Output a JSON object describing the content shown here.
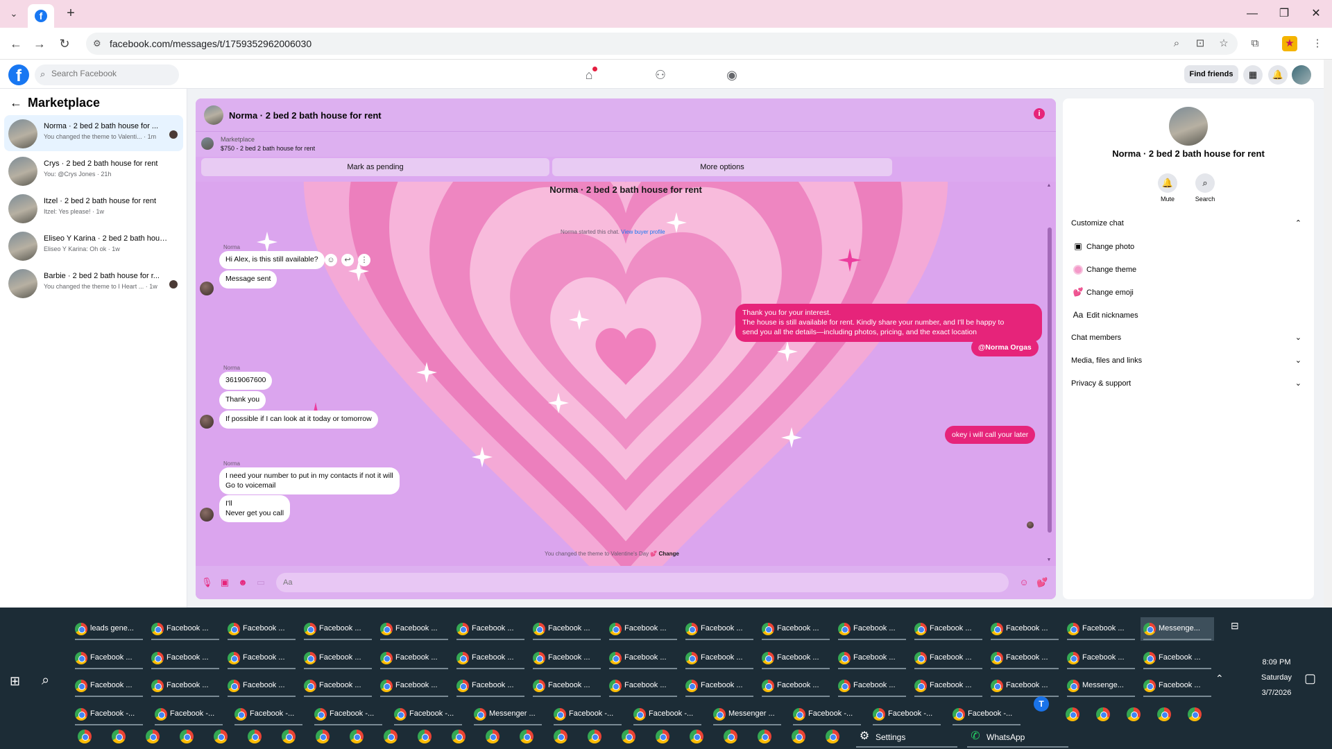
{
  "browser": {
    "url": "facebook.com/messages/t/1759352962006030",
    "new_tab": "+",
    "controls": {
      "minimize": "—",
      "maximize": "❐",
      "close": "✕"
    }
  },
  "fb_header": {
    "search_placeholder": "Search Facebook",
    "find_friends": "Find friends"
  },
  "sidebar": {
    "title": "Marketplace",
    "conversations": [
      {
        "name": "Norma · 2 bed 2 bath house for ...",
        "sub": "You changed the theme to Valenti... · 1m"
      },
      {
        "name": "Crys · 2 bed 2 bath house for rent",
        "sub": "You: @Crys Jones · 21h"
      },
      {
        "name": "Itzel · 2 bed 2 bath house for rent",
        "sub": "Itzel: Yes please! · 1w"
      },
      {
        "name": "Eliseo Y Karina · 2 bed 2 bath hous...",
        "sub": "Eliseo Y Karina: Oh ok · 1w"
      },
      {
        "name": "Barbie · 2 bed 2 bath house for r...",
        "sub": "You changed the theme to I Heart ... · 1w"
      }
    ]
  },
  "chat": {
    "title": "Norma · 2 bed 2 bath house for rent",
    "marketplace_label": "Marketplace",
    "listing": "$750 - 2 bed 2 bath house for rent",
    "mark_pending": "Mark as pending",
    "more_options": "More options",
    "body_title": "Norma · 2 bed 2 bath house for rent",
    "started_text": "Norma started this chat.",
    "view_profile": "View buyer profile",
    "sender": "Norma",
    "msg1": "Hi Alex, is this still available?",
    "msg2": "Message sent",
    "out1_line1": "Thank you for your interest.",
    "out1_line2": "The house is still available for rent. Kindly share your number, and I'll be happy to",
    "out1_line3": "send you all the details—including photos, pricing, and the exact location",
    "out_mention": "@Norma Orgas",
    "msg3": "3619067600",
    "msg4": "Thank you",
    "msg5": "If possible if I can look at it today or tomorrow",
    "out2": "okey i will call your later",
    "msg6_line1": "I need your number to put in my contacts if not it will",
    "msg6_line2": "Go to voicemail",
    "msg7_line1": "I'll",
    "msg7_line2": "Never get you call",
    "theme_notice": "You changed the theme to Valentine's Day 💕",
    "theme_change": "Change",
    "composer_placeholder": "Aa",
    "theme_colors": {
      "accent": "#e6247a",
      "background": "#dca9f0"
    }
  },
  "right_panel": {
    "name": "Norma · 2 bed 2 bath house for rent",
    "mute": "Mute",
    "search": "Search",
    "customize_chat": "Customize chat",
    "change_photo": "Change photo",
    "change_theme": "Change theme",
    "change_emoji": "Change emoji",
    "edit_nicknames": "Edit nicknames",
    "aa": "Aa",
    "chat_members": "Chat members",
    "media_files": "Media, files and links",
    "privacy": "Privacy & support"
  },
  "taskbar": {
    "row1": [
      "leads gene...",
      "Facebook ...",
      "Facebook ...",
      "Facebook ...",
      "Facebook ...",
      "Facebook ...",
      "Facebook ...",
      "Facebook ...",
      "Facebook ...",
      "Facebook ...",
      "Facebook ...",
      "Facebook ...",
      "Facebook ...",
      "Facebook ...",
      "Messenge..."
    ],
    "row2": [
      "Facebook ...",
      "Facebook ...",
      "Facebook ...",
      "Facebook ...",
      "Facebook ...",
      "Facebook ...",
      "Facebook ...",
      "Facebook ...",
      "Facebook ...",
      "Facebook ...",
      "Facebook ...",
      "Facebook ...",
      "Facebook ...",
      "Facebook ...",
      "Facebook ..."
    ],
    "row3": [
      "Facebook ...",
      "Facebook ...",
      "Facebook ...",
      "Facebook ...",
      "Facebook ...",
      "Facebook ...",
      "Facebook ...",
      "Facebook ...",
      "Facebook ...",
      "Facebook ...",
      "Facebook ...",
      "Facebook ...",
      "Facebook ...",
      "Messenge...",
      "Facebook ..."
    ],
    "row4": [
      "Facebook -...",
      "Facebook -...",
      "Facebook -...",
      "Facebook -...",
      "Facebook -...",
      "Messenger ...",
      "Facebook -...",
      "Facebook -...",
      "Messenger ...",
      "Facebook -...",
      "Facebook -...",
      "Facebook -..."
    ],
    "settings": "Settings",
    "whatsapp": "WhatsApp",
    "time": "8:09 PM",
    "day": "Saturday",
    "date": "3/7/2026"
  }
}
